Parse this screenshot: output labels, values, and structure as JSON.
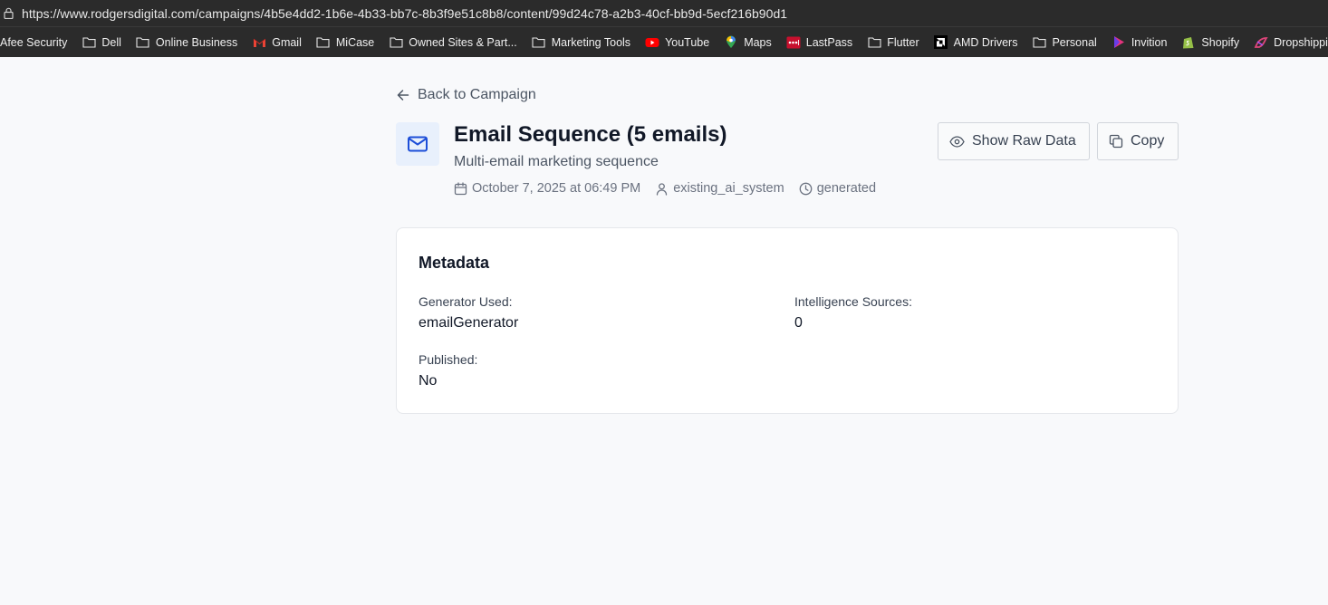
{
  "browser": {
    "url": "https://www.rodgersdigital.com/campaigns/4b5e4dd2-1b6e-4b33-bb7c-8b3f9e51c8b8/content/99d24c78-a2b3-40cf-bb9d-5ecf216b90d1",
    "bookmarks": [
      {
        "label": "Afee Security",
        "icon": "none"
      },
      {
        "label": "Dell",
        "icon": "folder-icon"
      },
      {
        "label": "Online Business",
        "icon": "folder-icon"
      },
      {
        "label": "Gmail",
        "icon": "gmail-icon"
      },
      {
        "label": "MiCase",
        "icon": "folder-icon"
      },
      {
        "label": "Owned Sites & Part...",
        "icon": "folder-icon"
      },
      {
        "label": "Marketing Tools",
        "icon": "folder-icon"
      },
      {
        "label": "YouTube",
        "icon": "youtube-icon"
      },
      {
        "label": "Maps",
        "icon": "maps-icon"
      },
      {
        "label": "LastPass",
        "icon": "lastpass-icon"
      },
      {
        "label": "Flutter",
        "icon": "folder-icon"
      },
      {
        "label": "AMD Drivers",
        "icon": "amd-icon"
      },
      {
        "label": "Personal",
        "icon": "folder-icon"
      },
      {
        "label": "Invition",
        "icon": "invition-icon"
      },
      {
        "label": "Shopify",
        "icon": "shopify-icon"
      },
      {
        "label": "Dropshipping Phon...",
        "icon": "dropshipping-icon"
      }
    ]
  },
  "page": {
    "back_label": "Back to Campaign",
    "title": "Email Sequence (5 emails)",
    "subtitle": "Multi-email marketing sequence",
    "meta": {
      "date": "October 7, 2025 at 06:49 PM",
      "author": "existing_ai_system",
      "status": "generated"
    },
    "actions": {
      "raw_label": "Show Raw Data",
      "copy_label": "Copy"
    }
  },
  "metadata_card": {
    "title": "Metadata",
    "generator_label": "Generator Used:",
    "generator_value": "emailGenerator",
    "sources_label": "Intelligence Sources:",
    "sources_value": "0",
    "published_label": "Published:",
    "published_value": "No"
  },
  "colors": {
    "accent": "#1d4ed8",
    "icon_bg": "#e8f0fc",
    "chrome": "#2b2b2b"
  }
}
